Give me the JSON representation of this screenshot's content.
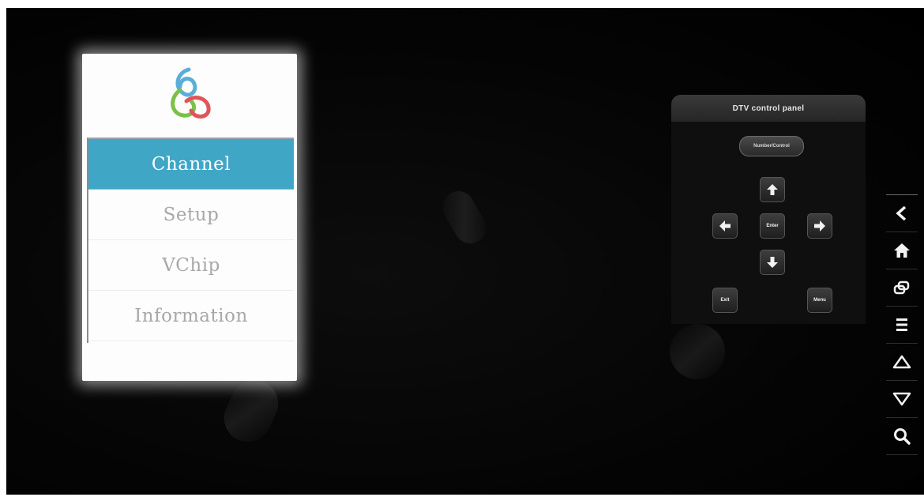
{
  "menu": {
    "items": [
      {
        "label": "Channel",
        "selected": true
      },
      {
        "label": "Setup",
        "selected": false
      },
      {
        "label": "VChip",
        "selected": false
      },
      {
        "label": "Information",
        "selected": false
      }
    ]
  },
  "dtv_panel": {
    "title": "DTV control panel",
    "number_control_label": "Number/Control",
    "enter_label": "Enter",
    "exit_label": "Exit",
    "menu_label": "Menu"
  },
  "nav_bar": {
    "icons": [
      "back-icon",
      "home-icon",
      "recent-apps-icon",
      "menu-icon",
      "volume-up-icon",
      "volume-down-icon",
      "search-icon"
    ]
  },
  "colors": {
    "selected_item": "#3fa6c6",
    "screen_background": "#050505"
  }
}
